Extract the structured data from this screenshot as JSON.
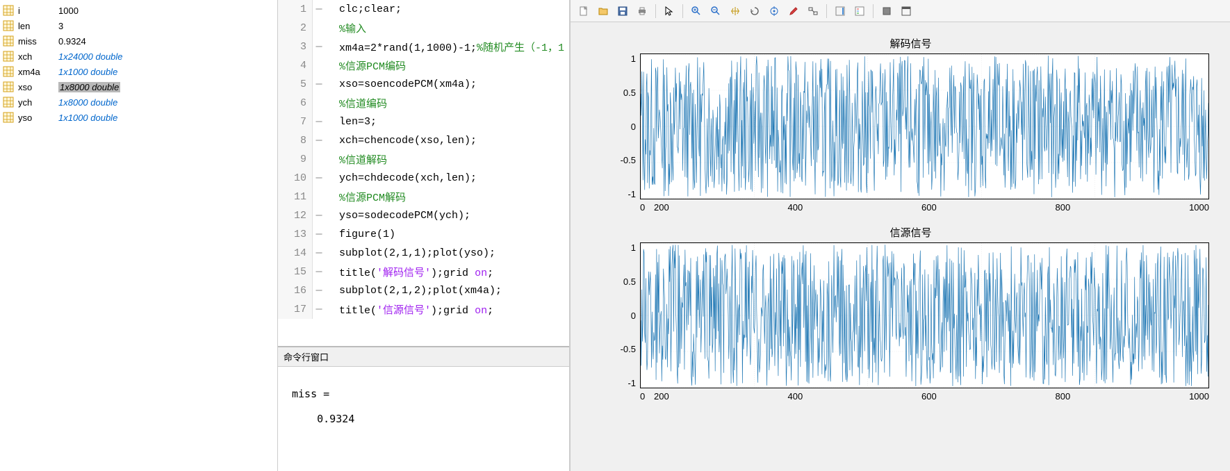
{
  "workspace": {
    "vars": [
      {
        "name": "i",
        "value": "1000",
        "link": false,
        "selected": false
      },
      {
        "name": "len",
        "value": "3",
        "link": false,
        "selected": false
      },
      {
        "name": "miss",
        "value": "0.9324",
        "link": false,
        "selected": false
      },
      {
        "name": "xch",
        "value": "1x24000 double",
        "link": true,
        "selected": false
      },
      {
        "name": "xm4a",
        "value": "1x1000 double",
        "link": true,
        "selected": false
      },
      {
        "name": "xso",
        "value": "1x8000 double",
        "link": true,
        "selected": true
      },
      {
        "name": "ych",
        "value": "1x8000 double",
        "link": true,
        "selected": false
      },
      {
        "name": "yso",
        "value": "1x1000 double",
        "link": true,
        "selected": false
      }
    ]
  },
  "editor": {
    "lines": [
      {
        "n": 1,
        "dash": true,
        "segs": [
          {
            "t": "clc;clear;",
            "c": ""
          }
        ]
      },
      {
        "n": 2,
        "dash": false,
        "segs": [
          {
            "t": "%输入",
            "c": "c-cm"
          }
        ]
      },
      {
        "n": 3,
        "dash": true,
        "segs": [
          {
            "t": "xm4a=2*rand(1,1000)-1;",
            "c": ""
          },
          {
            "t": "%随机产生（-1，1",
            "c": "c-cm"
          }
        ]
      },
      {
        "n": 4,
        "dash": false,
        "segs": [
          {
            "t": "%信源PCM编码",
            "c": "c-cm"
          }
        ]
      },
      {
        "n": 5,
        "dash": true,
        "segs": [
          {
            "t": "xso=soencodePCM(xm4a);",
            "c": ""
          }
        ]
      },
      {
        "n": 6,
        "dash": false,
        "segs": [
          {
            "t": "%信道编码",
            "c": "c-cm"
          }
        ]
      },
      {
        "n": 7,
        "dash": true,
        "segs": [
          {
            "t": "len=3;",
            "c": ""
          }
        ]
      },
      {
        "n": 8,
        "dash": true,
        "segs": [
          {
            "t": "xch=chencode(xso,len);",
            "c": ""
          }
        ]
      },
      {
        "n": 9,
        "dash": false,
        "segs": [
          {
            "t": "%信道解码",
            "c": "c-cm"
          }
        ]
      },
      {
        "n": 10,
        "dash": true,
        "segs": [
          {
            "t": "ych=chdecode(xch,len);",
            "c": ""
          }
        ]
      },
      {
        "n": 11,
        "dash": false,
        "segs": [
          {
            "t": "%信源PCM解码",
            "c": "c-cm"
          }
        ]
      },
      {
        "n": 12,
        "dash": true,
        "segs": [
          {
            "t": "yso=sodecodePCM(ych);",
            "c": ""
          }
        ]
      },
      {
        "n": 13,
        "dash": true,
        "segs": [
          {
            "t": "figure(1)",
            "c": ""
          }
        ]
      },
      {
        "n": 14,
        "dash": true,
        "segs": [
          {
            "t": "subplot(2,1,1);plot(yso);",
            "c": ""
          }
        ]
      },
      {
        "n": 15,
        "dash": true,
        "segs": [
          {
            "t": "title(",
            "c": ""
          },
          {
            "t": "'解码信号'",
            "c": "c-str"
          },
          {
            "t": ");",
            "c": ""
          },
          {
            "t": "grid ",
            "c": ""
          },
          {
            "t": "on",
            "c": "c-str"
          },
          {
            "t": ";",
            "c": ""
          }
        ]
      },
      {
        "n": 16,
        "dash": true,
        "segs": [
          {
            "t": "subplot(2,1,2);plot(xm4a);",
            "c": ""
          }
        ]
      },
      {
        "n": 17,
        "dash": true,
        "segs": [
          {
            "t": "title(",
            "c": ""
          },
          {
            "t": "'信源信号'",
            "c": "c-str"
          },
          {
            "t": ");",
            "c": ""
          },
          {
            "t": "grid ",
            "c": ""
          },
          {
            "t": "on",
            "c": "c-str"
          },
          {
            "t": ";",
            "c": ""
          }
        ]
      }
    ]
  },
  "command_window": {
    "title": "命令行窗口",
    "output": "\nmiss =\n\n    0.9324\n"
  },
  "toolbar": {
    "icons": [
      "new-icon",
      "open-icon",
      "save-icon",
      "print-icon",
      "pointer-icon",
      "zoom-in-icon",
      "zoom-out-icon",
      "pan-icon",
      "rotate-icon",
      "datatip-icon",
      "brush-icon",
      "link-icon",
      "colorbar-icon",
      "legend-icon",
      "hide-icon",
      "dock-icon"
    ]
  },
  "chart_data": [
    {
      "type": "line",
      "title": "解码信号",
      "xlabel": "",
      "ylabel": "",
      "xlim": [
        0,
        1000
      ],
      "ylim": [
        -1,
        1
      ],
      "xticks": [
        0,
        200,
        400,
        600,
        800,
        1000
      ],
      "yticks": [
        -1,
        -0.5,
        0,
        0.5,
        1
      ],
      "grid": true,
      "description": "Random uniform noise signal in [-1,1], 1000 samples (decoded signal yso)"
    },
    {
      "type": "line",
      "title": "信源信号",
      "xlabel": "",
      "ylabel": "",
      "xlim": [
        0,
        1000
      ],
      "ylim": [
        -1,
        1
      ],
      "xticks": [
        0,
        200,
        400,
        600,
        800,
        1000
      ],
      "yticks": [
        -1,
        -0.5,
        0,
        0.5,
        1
      ],
      "grid": true,
      "description": "Random uniform noise signal in [-1,1], 1000 samples (source signal xm4a = 2*rand(1,1000)-1)"
    }
  ]
}
